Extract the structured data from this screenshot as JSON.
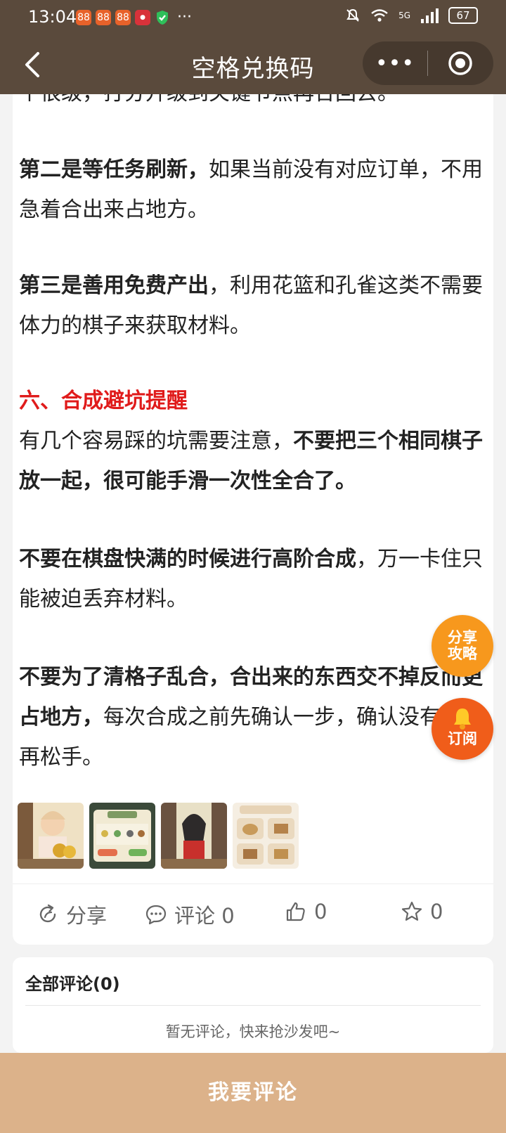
{
  "status": {
    "time": "13:04",
    "network": "5G",
    "battery": "67"
  },
  "nav": {
    "title": "空格兑换码",
    "more_icon": "more-dots-icon",
    "target_icon": "target-icon"
  },
  "article": {
    "cut_line": "个很级，打分升级到关键节点再合回去。",
    "p1_bold": "第二是等任务刷新，",
    "p1_rest": "如果当前没有对应订单，不用急着合出来占地方。",
    "p2_bold": "第三是善用免费产出",
    "p2_rest": "，利用花篮和孔雀这类不需要体力的棋子来获取材料。",
    "heading": "六、合成避坑提醒",
    "p3_rest": "有几个容易踩的坑需要注意，",
    "p3_bold": "不要把三个相同棋子放一起，很可能手滑一次性全合了。",
    "p4_bold": "不要在棋盘快满的时候进行高阶合成",
    "p4_rest": "，万一卡住只能被迫丢弃材料。",
    "p5_bold": "不要为了清格子乱合，合出来的东西交不掉反而更占地方，",
    "p5_rest": "每次合成之前先确认一步，确认没有失误再松手。"
  },
  "actions": {
    "share_label": "分享",
    "comment_label": "评论 0",
    "like_count": "0",
    "star_count": "0"
  },
  "floating": {
    "share_guide": "分享攻略",
    "subscribe": "订阅"
  },
  "comments": {
    "header": "全部评论(0)",
    "empty_text": "暂无评论，快来抢沙发吧~"
  },
  "bottom": {
    "comment_button": "我要评论"
  }
}
